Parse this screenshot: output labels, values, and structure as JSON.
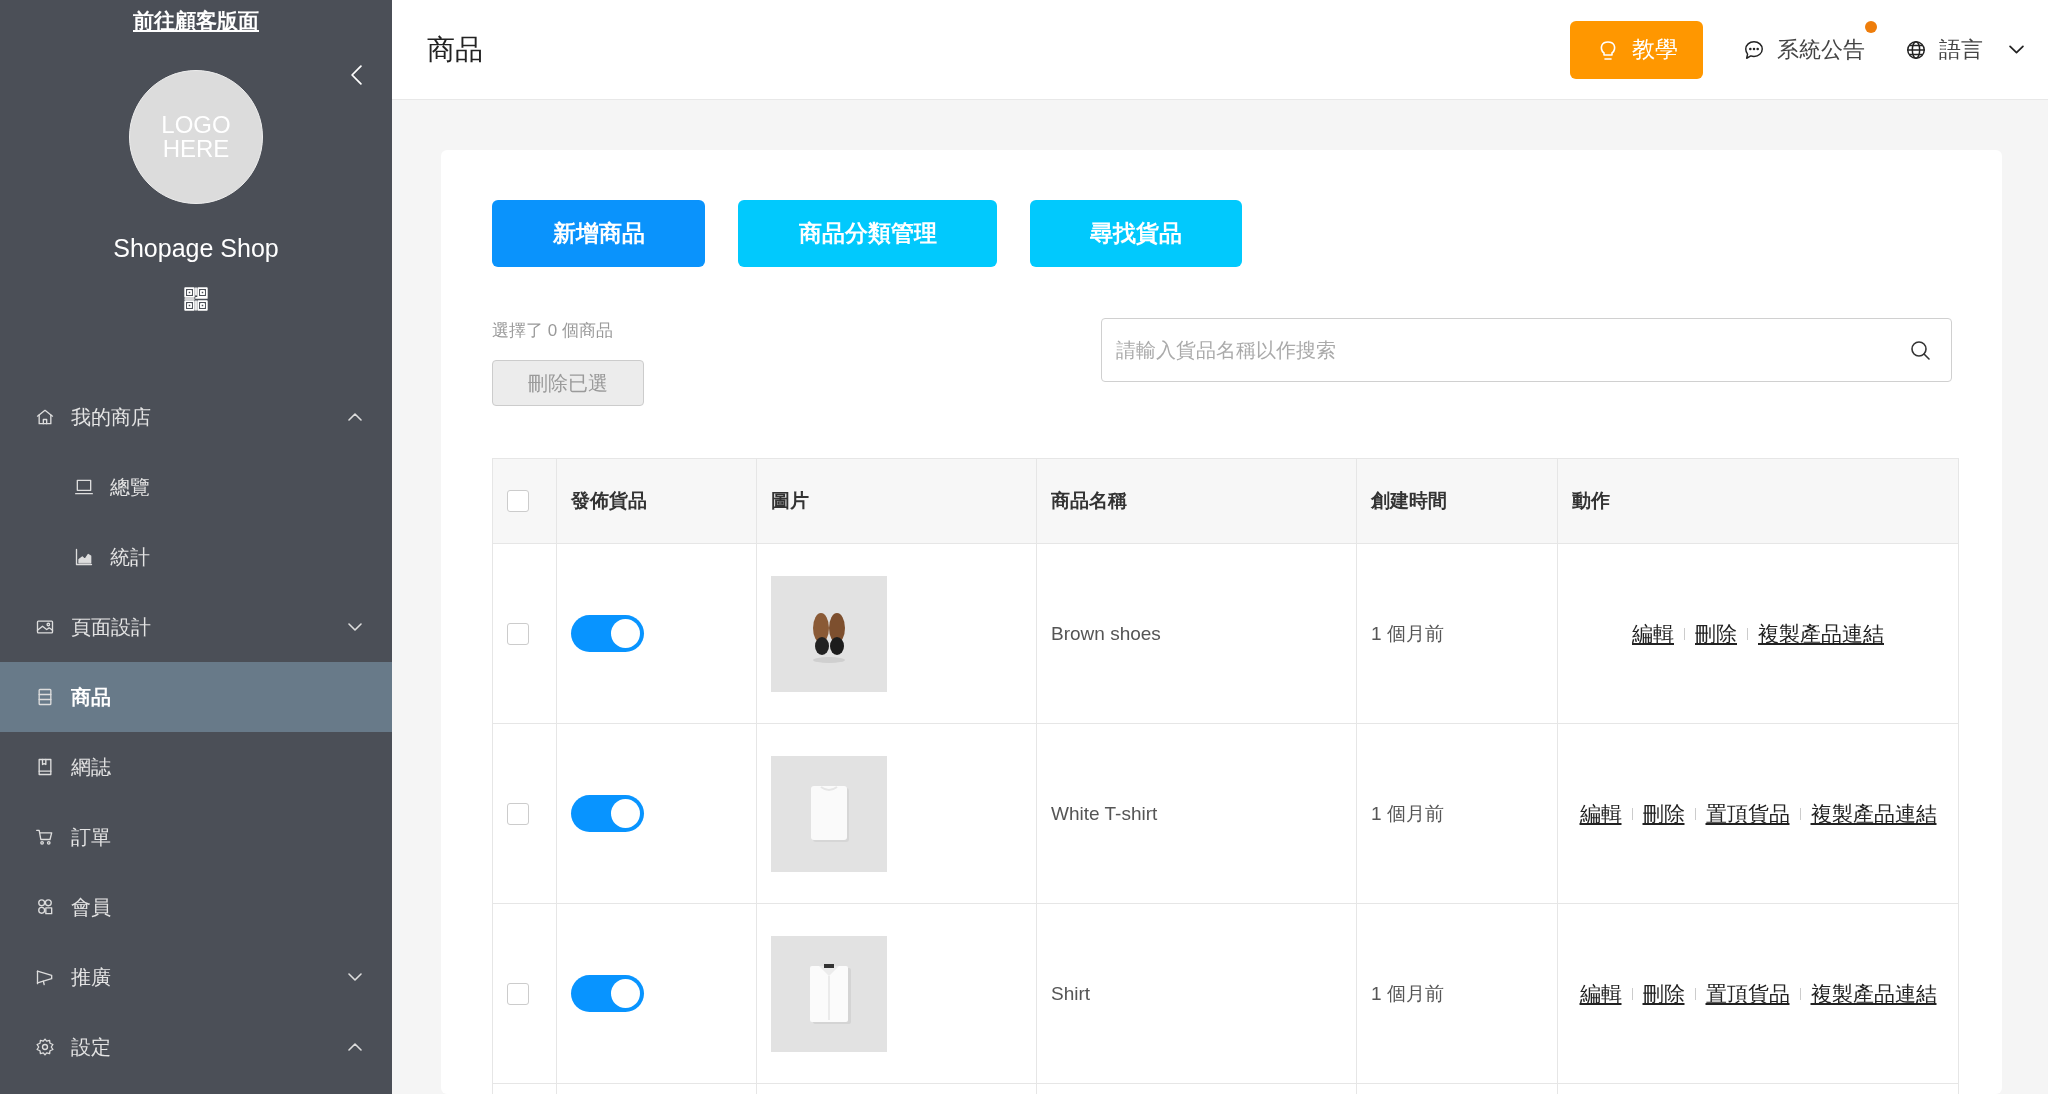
{
  "sidebar": {
    "storefront_link": "前往顧客版面",
    "logo": "LOGO\nHERE",
    "shop_name": "Shopage Shop",
    "items": [
      {
        "label": "我的商店",
        "expanded": true,
        "selected": false,
        "children": [
          {
            "label": "總覽",
            "selected": false
          },
          {
            "label": "統計",
            "selected": false
          }
        ]
      },
      {
        "label": "頁面設計",
        "expanded": false,
        "selected": false
      },
      {
        "label": "商品",
        "selected": true
      },
      {
        "label": "網誌",
        "selected": false
      },
      {
        "label": "訂單",
        "selected": false
      },
      {
        "label": "會員",
        "selected": false
      },
      {
        "label": "推廣",
        "expanded": false,
        "selected": false
      },
      {
        "label": "設定",
        "expanded": true,
        "selected": false
      }
    ]
  },
  "header": {
    "title": "商品",
    "tutorial_button": "教學",
    "announcements": {
      "label": "系統公告",
      "unread": true
    },
    "language": "語言"
  },
  "toolbar": {
    "buttons": [
      {
        "label": "新增商品",
        "kind": "primary"
      },
      {
        "label": "商品分類管理",
        "kind": "secondary"
      },
      {
        "label": "尋找貨品",
        "kind": "secondary"
      }
    ]
  },
  "selection": {
    "count_text": "選擇了 0 個商品",
    "delete_button": {
      "label": "刪除已選",
      "disabled": true
    }
  },
  "search": {
    "placeholder": "請輸入貨品名稱以作搜索"
  },
  "table": {
    "select_all": {
      "checked": false
    },
    "columns": [
      "發佈貨品",
      "圖片",
      "商品名稱",
      "創建時間",
      "動作"
    ],
    "rows": [
      {
        "checked": false,
        "published": {
          "on": true
        },
        "image": {
          "kind": "picture"
        },
        "name": "Brown shoes",
        "created": "1 個月前",
        "actions": [
          "編輯",
          "刪除",
          "複製產品連結"
        ]
      },
      {
        "checked": false,
        "published": {
          "on": true
        },
        "image": {
          "kind": "picture"
        },
        "name": "White T-shirt",
        "created": "1 個月前",
        "actions": [
          "編輯",
          "刪除",
          "置頂貨品",
          "複製產品連結"
        ]
      },
      {
        "checked": false,
        "published": {
          "on": true
        },
        "image": {
          "kind": "picture"
        },
        "name": "Shirt",
        "created": "1 個月前",
        "actions": [
          "編輯",
          "刪除",
          "置頂貨品",
          "複製產品連結"
        ]
      }
    ]
  }
}
